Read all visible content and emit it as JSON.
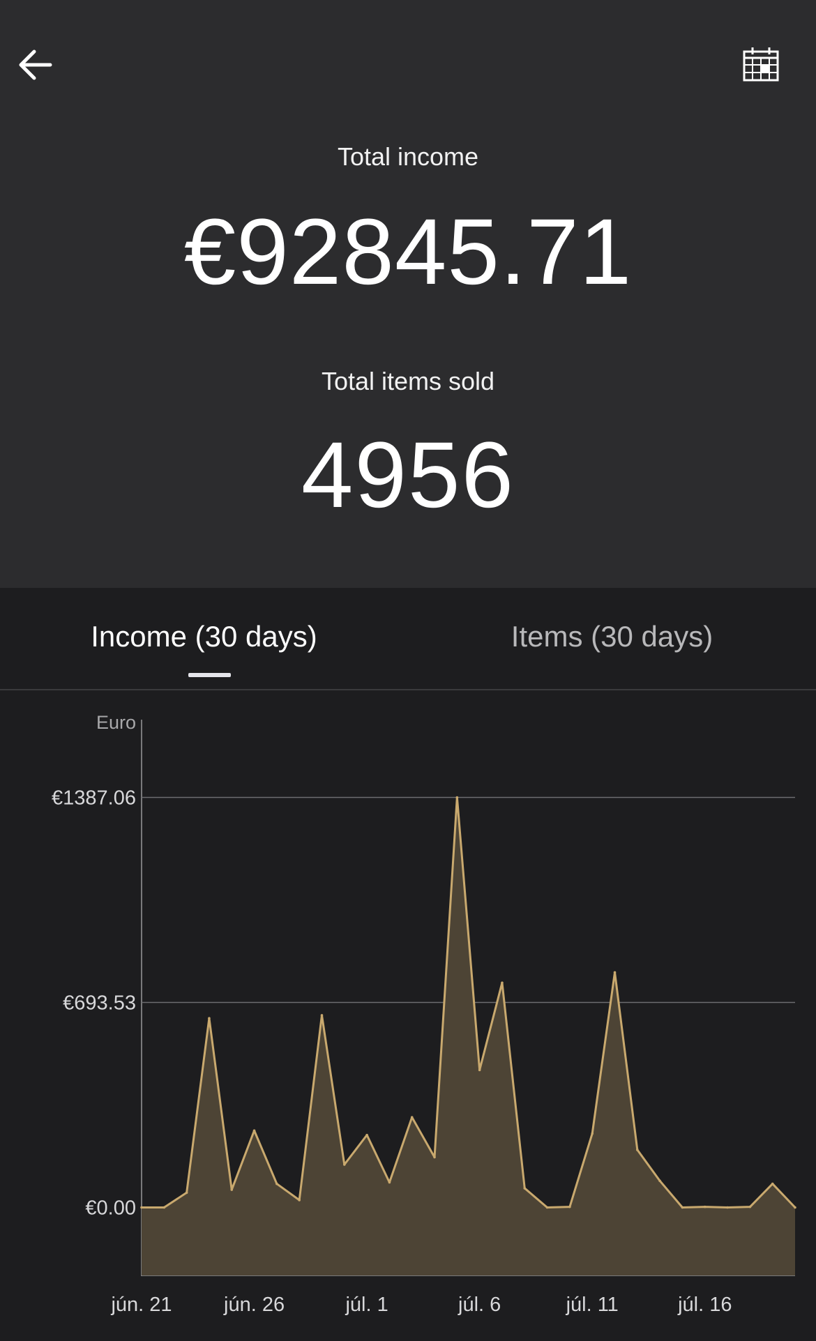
{
  "header": {
    "back_icon": "arrow-left-icon",
    "calendar_icon": "calendar-icon",
    "total_income_label": "Total income",
    "total_income_value": "€92845.71",
    "total_items_label": "Total items sold",
    "total_items_value": "4956"
  },
  "tabs": [
    {
      "label": "Income (30 days)",
      "active": true
    },
    {
      "label": "Items (30 days)",
      "active": false
    }
  ],
  "colors": {
    "header_bg": "#2c2c2e",
    "page_bg": "#1d1d1f",
    "line": "#c9a96e",
    "fill": "#4d4435"
  },
  "chart_data": {
    "type": "area",
    "unit_label": "Euro",
    "y_tick_labels": [
      "€1387.06",
      "€693.53",
      "€0.00"
    ],
    "y_ticks": [
      1387.06,
      693.53,
      0
    ],
    "ylim": [
      -230,
      1650
    ],
    "x_tick_labels": [
      "jún. 21",
      "jún. 26",
      "júl. 1",
      "júl. 6",
      "júl. 11",
      "júl. 16"
    ],
    "grid": true,
    "series": [
      {
        "x": [
          "jún. 20",
          "jún. 21",
          "jún. 22",
          "jún. 23",
          "jún. 24",
          "jún. 25",
          "jún. 26",
          "jún. 27",
          "jún. 28",
          "jún. 29",
          "jún. 30",
          "júl. 1",
          "júl. 2",
          "júl. 3",
          "júl. 4",
          "júl. 5",
          "júl. 6",
          "júl. 7",
          "júl. 8",
          "júl. 9",
          "júl. 10",
          "júl. 11",
          "júl. 12",
          "júl. 13",
          "júl. 14",
          "júl. 15",
          "júl. 16",
          "júl. 17",
          "júl. 18",
          "júl. 19"
        ],
        "values": [
          0,
          0,
          50,
          640,
          60,
          260,
          80,
          25,
          650,
          145,
          245,
          85,
          305,
          170,
          1387,
          465,
          760,
          65,
          0,
          2,
          250,
          795,
          195,
          90,
          0,
          2,
          0,
          2,
          80,
          0
        ]
      }
    ]
  }
}
